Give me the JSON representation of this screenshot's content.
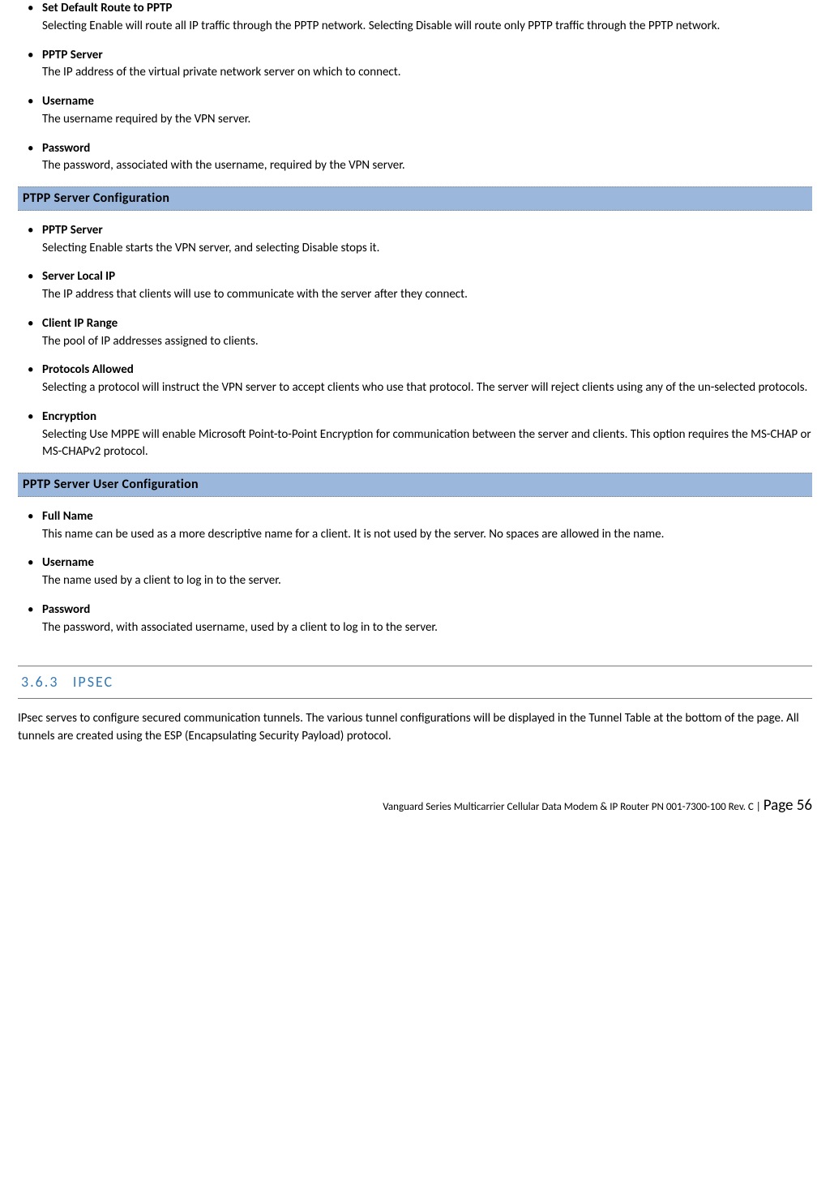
{
  "section1": {
    "items": [
      {
        "title": "Set Default Route to PPTP",
        "desc": "Selecting Enable will route all IP traffic through the PPTP network. Selecting Disable will route only PPTP traffic through the PPTP network."
      },
      {
        "title": "PPTP Server",
        "desc": "The IP address of the virtual private network server on which to connect."
      },
      {
        "title": "Username",
        "desc": "The username required by the VPN server."
      },
      {
        "title": "Password",
        "desc": "The password, associated with the username, required by the VPN server."
      }
    ]
  },
  "bar1": {
    "title": "PTPP Server Configuration"
  },
  "section2": {
    "items": [
      {
        "title": "PPTP Server",
        "desc": "Selecting Enable starts the VPN server, and selecting Disable stops it."
      },
      {
        "title": "Server Local IP",
        "desc": "The IP address that clients will use to communicate with the server after they connect."
      },
      {
        "title": "Client IP Range",
        "desc": "The pool of IP addresses assigned to clients."
      },
      {
        "title": "Protocols Allowed",
        "desc": "Selecting a protocol will instruct the VPN server to accept clients who use that protocol. The server will reject clients using any of the un-selected protocols."
      },
      {
        "title": "Encryption",
        "desc": "Selecting Use MPPE will enable Microsoft Point-to-Point Encryption for communication between the server and clients. This option requires the MS-CHAP or MS-CHAPv2 protocol."
      }
    ]
  },
  "bar2": {
    "title": "PPTP Server User Configuration"
  },
  "section3": {
    "items": [
      {
        "title": "Full Name",
        "desc": "This name can be used as a more descriptive name for a client. It is not used by the server. No spaces are allowed in the name."
      },
      {
        "title": "Username",
        "desc": "The name used by a client to log in to the server."
      },
      {
        "title": "Password",
        "desc": "The password, with associated username, used by a client to log in to the server."
      }
    ]
  },
  "heading": {
    "num": "3.6.3",
    "title": "IPSEC"
  },
  "ipsec_intro": "IPsec serves to configure secured communication tunnels. The various tunnel configurations will be displayed in the Tunnel Table at the bottom of the page. All tunnels are created using the ESP (Encapsulating Security Payload) protocol.",
  "footer": {
    "left": "Vanguard Series Multicarrier Cellular Data Modem & IP Router PN 001-7300-100 Rev. C",
    "sep": " | ",
    "page_label": "Page 56"
  }
}
